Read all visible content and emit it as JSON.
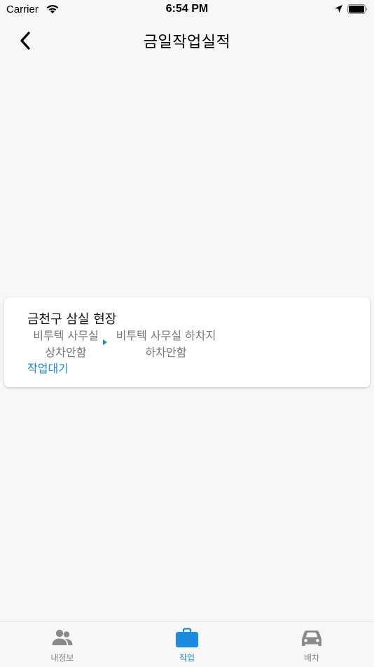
{
  "status_bar": {
    "carrier": "Carrier",
    "time": "6:54 PM"
  },
  "nav": {
    "title": "금일작업실적",
    "back_icon": "chevron-left-icon"
  },
  "card": {
    "title": "금천구 삼실 현장",
    "from_line1": "비투텍 사무실",
    "from_line2": "상차안함",
    "to_line1": "비투텍 사무실 하차지",
    "to_line2": "하차안함",
    "status": "작업대기"
  },
  "tabs": [
    {
      "label": "내정보",
      "icon": "people-icon",
      "active": false
    },
    {
      "label": "작업",
      "icon": "briefcase-icon",
      "active": true
    },
    {
      "label": "배차",
      "icon": "car-icon",
      "active": false
    }
  ],
  "colors": {
    "accent": "#1a8be0",
    "background": "#f7f7f7",
    "inactive": "#8a8a8a"
  }
}
